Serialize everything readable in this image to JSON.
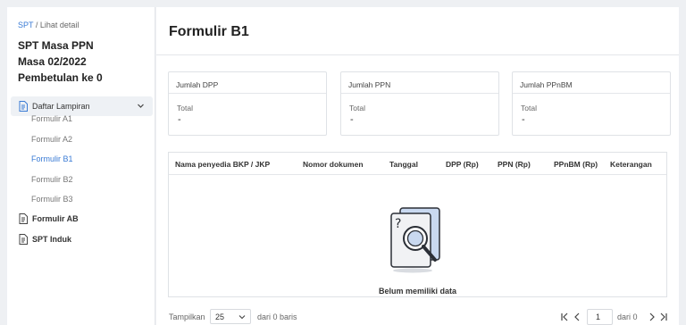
{
  "sidebar": {
    "breadcrumb": {
      "link": "SPT",
      "separator": " / ",
      "current": "Lihat detail"
    },
    "title_line1": "SPT Masa PPN",
    "title_line2": "Masa 02/2022",
    "title_line3": "Pembetulan ke 0",
    "group_label": "Daftar Lampiran",
    "sub_items": [
      "Formulir A1",
      "Formulir A2",
      "Formulir B1",
      "Formulir B2",
      "Formulir B3"
    ],
    "active_item": "Formulir B1",
    "items": [
      "Formulir AB",
      "SPT Induk"
    ]
  },
  "main": {
    "title": "Formulir B1",
    "cards": [
      {
        "header": "Jumlah DPP",
        "total_label": "Total",
        "value": "-"
      },
      {
        "header": "Jumlah PPN",
        "total_label": "Total",
        "value": "-"
      },
      {
        "header": "Jumlah PPnBM",
        "total_label": "Total",
        "value": "-"
      }
    ],
    "table": {
      "columns": [
        "Nama penyedia BKP / JKP",
        "Nomor dokumen",
        "Tanggal",
        "DPP (Rp)",
        "PPN (Rp)",
        "PPnBM (Rp)",
        "Keterangan"
      ],
      "empty_text": "Belum memiliki data"
    },
    "pager": {
      "show_label": "Tampilkan",
      "page_size": "25",
      "rows_text": "dari 0 baris",
      "page": "1",
      "of_text": "dari 0"
    }
  },
  "colors": {
    "accent": "#3a7bd5",
    "active_bg": "#eef1f5"
  }
}
